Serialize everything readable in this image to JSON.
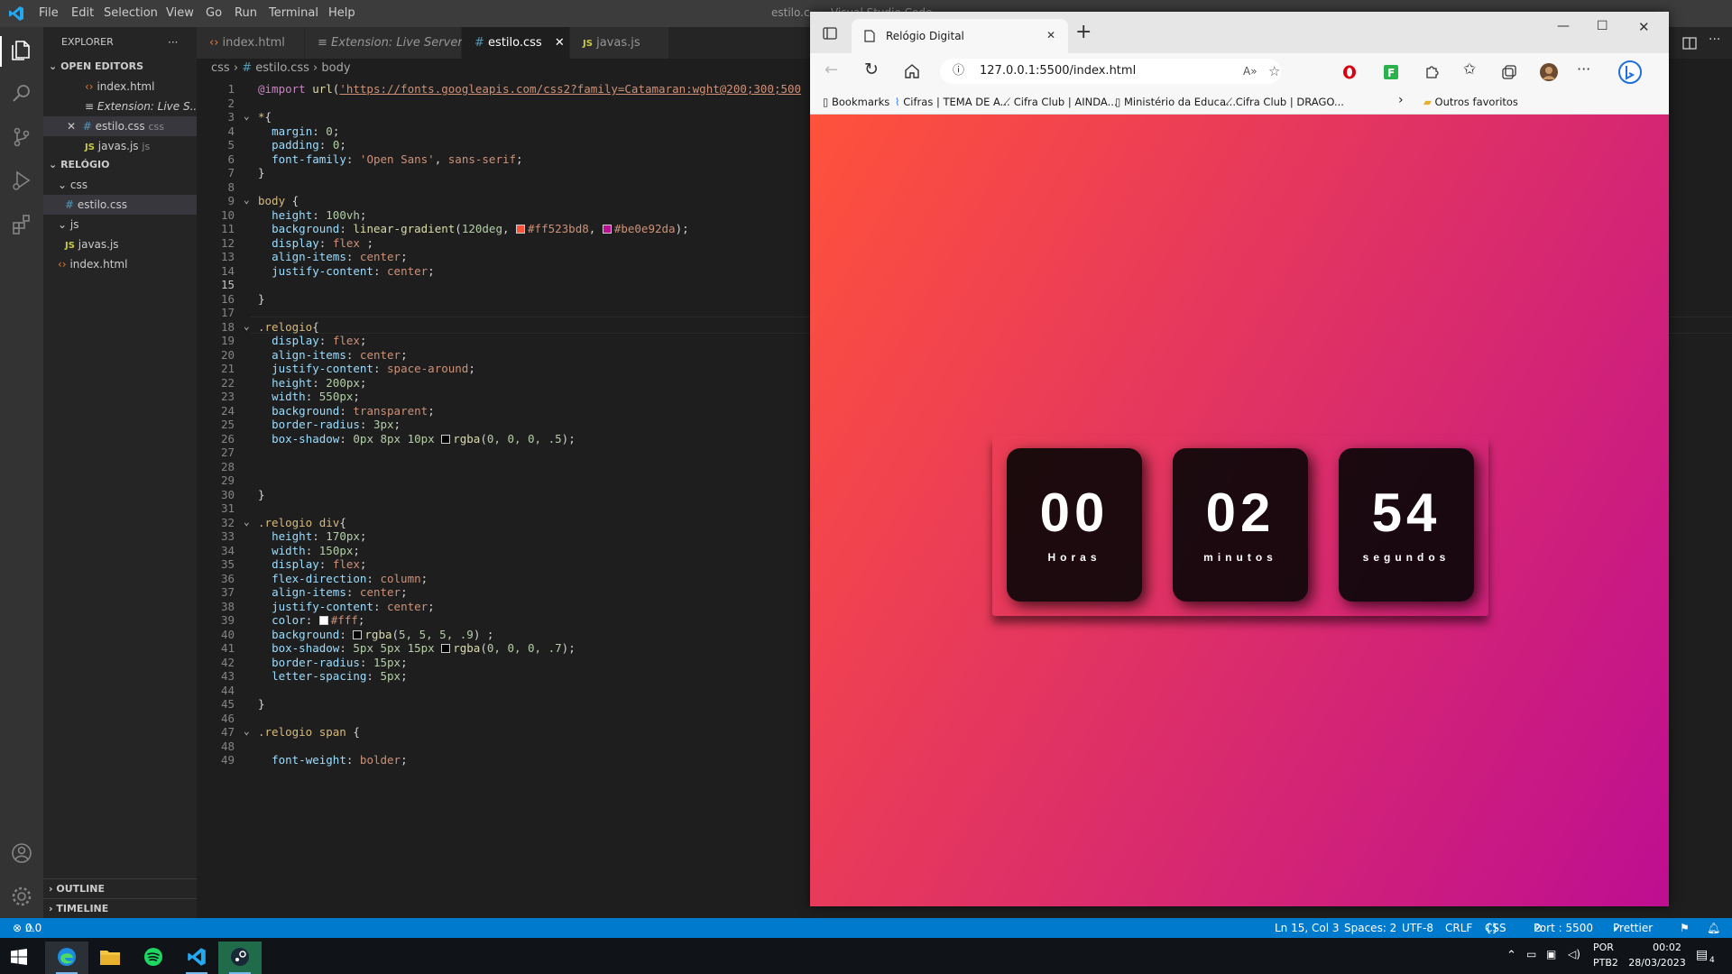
{
  "vscode": {
    "menu": [
      "File",
      "Edit",
      "Selection",
      "View",
      "Go",
      "Run",
      "Terminal",
      "Help"
    ],
    "window_title": "estilo.c... - Visual Studio Code",
    "sidebar": {
      "explorer_label": "EXPLORER",
      "open_editors_label": "OPEN EDITORS",
      "open_editors": [
        {
          "name": "index.html",
          "hint": ""
        },
        {
          "name": "Extension: Live S...",
          "hint": ""
        },
        {
          "name": "estilo.css",
          "hint": "css"
        },
        {
          "name": "javas.js",
          "hint": "js"
        }
      ],
      "folder_label": "RELÓGIO",
      "tree": [
        {
          "name": "css"
        },
        {
          "name": "estilo.css"
        },
        {
          "name": "js"
        },
        {
          "name": "javas.js"
        },
        {
          "name": "index.html"
        }
      ],
      "outline_label": "OUTLINE",
      "timeline_label": "TIMELINE"
    },
    "tabs": [
      {
        "label": "index.html"
      },
      {
        "label": "Extension: Live Server"
      },
      {
        "label": "estilo.css"
      },
      {
        "label": "javas.js"
      }
    ],
    "breadcrumb": {
      "folder": "css",
      "file": "estilo.css",
      "symbol": "body"
    },
    "statusbar": {
      "problems": "0",
      "warnings": "0",
      "position": "Ln 15, Col 3",
      "spaces": "Spaces: 2",
      "encoding": "UTF-8",
      "eol": "CRLF",
      "language": "CSS",
      "port": "Port : 5500",
      "prettier": "Prettier"
    }
  },
  "browser": {
    "tab_title": "Relógio Digital",
    "url": "127.0.0.1:5500/index.html",
    "bookmarks": [
      {
        "label": "Bookmarks"
      },
      {
        "label": "Cifras | TEMA DE A..."
      },
      {
        "label": "Cifra Club | AINDA..."
      },
      {
        "label": "Ministério da Educa..."
      },
      {
        "label": "Cifra Club | DRAGO..."
      }
    ],
    "other_favorites": "Outros favoritos"
  },
  "clock": {
    "hours": "00",
    "hours_label": "Horas",
    "minutes": "02",
    "minutes_label": "minutos",
    "seconds": "54",
    "seconds_label": "segundos"
  },
  "taskbar": {
    "lang": "POR",
    "layout": "PTB2",
    "time": "00:02",
    "date": "28/03/2023",
    "notifications": "4"
  },
  "colors": {
    "gradient_start": "#ff523b",
    "gradient_end": "#be0e92",
    "statusbar": "#007acc"
  }
}
